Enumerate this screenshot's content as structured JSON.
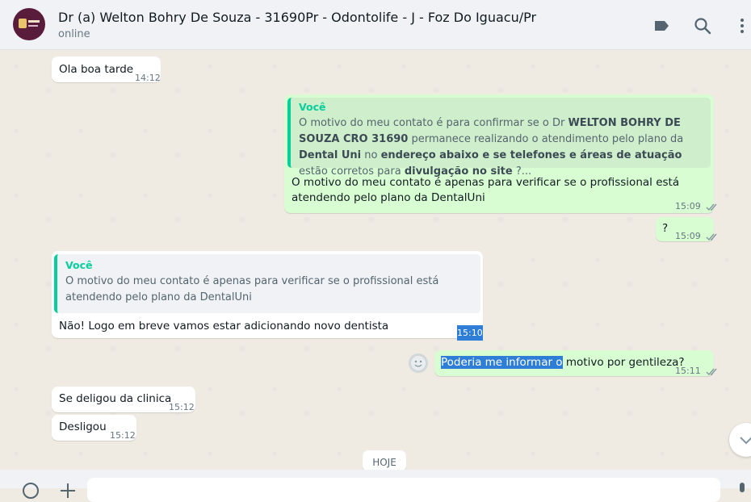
{
  "header": {
    "title": "Dr (a) Welton Bohry De Souza - 31690Pr - Odontolife - J - Foz Do Iguacu/Pr",
    "status": "online",
    "icons": [
      "label-icon",
      "search-icon",
      "menu-icon"
    ]
  },
  "messages": [
    {
      "direction": "in",
      "text": "Ola boa tarde",
      "time": "14:12"
    },
    {
      "direction": "out",
      "quote": {
        "author": "Você",
        "segments": [
          {
            "t": "O motivo do meu contato é para confirmar se o Dr ",
            "b": false
          },
          {
            "t": "WELTON BOHRY DE SOUZA CRO 31690",
            "b": true
          },
          {
            "t": " permanece realizando o atendimento pelo plano da ",
            "b": false
          },
          {
            "t": "Dental Uni",
            "b": true
          },
          {
            "t": " no ",
            "b": false
          },
          {
            "t": "endereço abaixo e se telefones e áreas de atuação",
            "b": true
          },
          {
            "t": " estão corretos para ",
            "b": false
          },
          {
            "t": "divulgação no site",
            "b": true
          },
          {
            "t": " ?...",
            "b": false
          }
        ]
      },
      "text": "O motivo do meu contato é apenas para verificar se o profissional está atendendo pelo plano da DentalUni",
      "time": "15:09"
    },
    {
      "direction": "out",
      "text": "?",
      "time": "15:09"
    },
    {
      "direction": "in",
      "quote": {
        "author": "Você",
        "text": "O motivo do meu contato é apenas para verificar se o profissional está atendendo pelo plano da DentalUni"
      },
      "text": "Não! Logo em breve vamos estar adicionando novo dentista",
      "time": "15:10"
    },
    {
      "direction": "out",
      "text_selected": "Poderia me informar o",
      "text_rest": " motivo por gentileza?",
      "time": "15:11"
    },
    {
      "direction": "in",
      "text": "Se deligou da clinica",
      "time": "15:12"
    },
    {
      "direction": "in",
      "text": "Desligou",
      "time": "15:12"
    }
  ],
  "date_chip": "HOJE",
  "colors": {
    "incoming_bubble": "#ffffff",
    "outgoing_bubble": "#d9fdd3",
    "quote_bar": "#06cf9c",
    "read_ticks": "#8696a0",
    "selection": "#2e7ed8"
  }
}
